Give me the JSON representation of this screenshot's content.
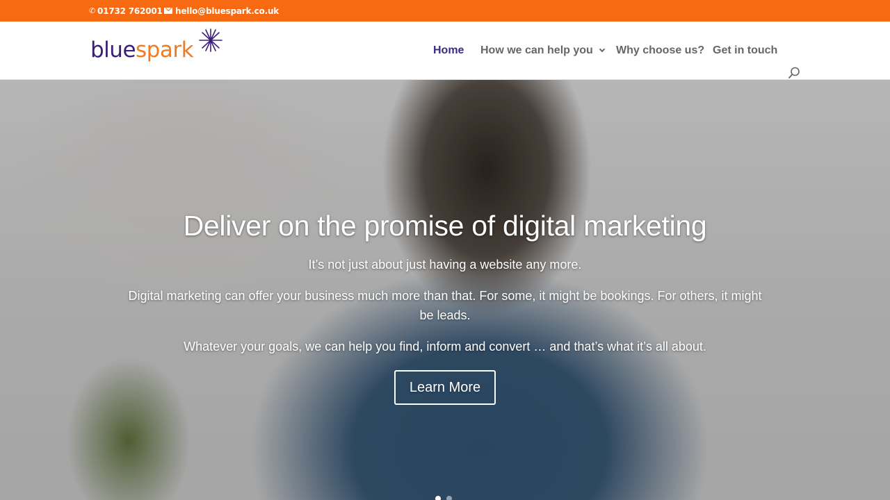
{
  "topbar": {
    "phone": "01732 762001",
    "email": "hello@bluespark.co.uk",
    "background": "#f76a12"
  },
  "logo": {
    "part1": "blue",
    "part2": "spark",
    "blue_color": "#3b1d7a",
    "orange_color": "#f47a1f"
  },
  "nav": {
    "items": [
      {
        "label": "Home",
        "active": true
      },
      {
        "label": "How we can help you",
        "has_dropdown": true
      },
      {
        "label": "Why choose us?"
      },
      {
        "label": "Get in touch"
      }
    ],
    "active_color": "#3b2a85",
    "search_icon": "search-icon"
  },
  "hero": {
    "title": "Deliver on the promise of digital marketing",
    "paragraphs": [
      "It’s not just about just having a website any more.",
      "Digital marketing can offer your business much more than that. For some, it might be bookings. For others, it might be leads.",
      "Whatever your goals, we can help you find, inform and convert … and that’s what it’s all about."
    ],
    "button_label": "Learn More",
    "slide_count": 2,
    "active_slide": 1
  }
}
